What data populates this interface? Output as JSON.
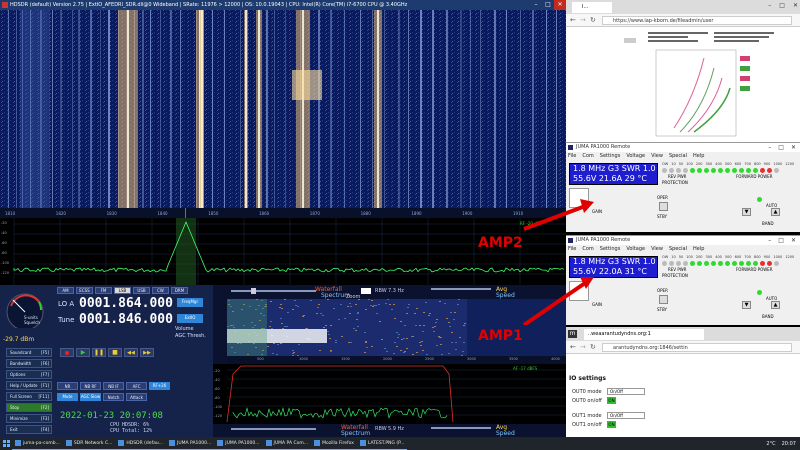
{
  "hdsdr": {
    "title": "HDSDR  (default)  Version 2.75  |  ExtIO_AFEDRI_SDR.dll@0 Wideband  |  SRate: 11976 > 12000  |  OS: 10.0.19043  |  CPU: Intel(R) Core(TM) i7-6700 CPU @ 3.40GHz",
    "freq_ticks": [
      "1810",
      "1820",
      "1830",
      "1840",
      "1850",
      "1860",
      "1870",
      "1880",
      "1890",
      "1900",
      "1910"
    ],
    "spectrum_db": [
      "-20",
      "-40",
      "-60",
      "-80",
      "-100",
      "-120"
    ],
    "spectrum_rf_label": "RF -20 dB",
    "s_meter_label": "S-units\nSquelch",
    "s_meter_value": "-29.7 dBm",
    "lo_label": "LO A",
    "lo_value": "0001.864.000",
    "tune_label": "Tune",
    "tune_value": "0001.846.000",
    "freqmgr": "FreqMgr",
    "extio": "ExtIO",
    "volume": "Volume",
    "agc_thresh": "AGC Thresh.",
    "mode_buttons": [
      "AM",
      "ECSS",
      "FM",
      "LSB",
      "USB",
      "CW",
      "DRM"
    ],
    "left_buttons": [
      {
        "label": "Soundcard",
        "key": "[F5]"
      },
      {
        "label": "Bandwidth",
        "key": "[F6]"
      },
      {
        "label": "Options",
        "key": "[F7]"
      },
      {
        "label": "Help / Update",
        "key": "[F1]"
      },
      {
        "label": "Full Screen",
        "key": "[F11]"
      },
      {
        "label": "Stop",
        "key": "[F2]"
      },
      {
        "label": "Minimize",
        "key": "[F3]"
      },
      {
        "label": "Exit",
        "key": "[F4]"
      }
    ],
    "filter_buttons": [
      "NR",
      "NB RF",
      "NB IF",
      "AFC",
      "RF+26"
    ],
    "agc_buttons": [
      "Mute",
      "AGC Slow",
      "Notch",
      "Attack"
    ],
    "datetime": "2022-01-23 20:07:08",
    "cpu_sdr": "CPU HDSDR:  6%",
    "cpu_total": "CPU Total:  12%",
    "waterfall_label": "Waterfall",
    "spectrum_label": "Spectrum",
    "rbw_label": "RBW",
    "rbw_value": "7.3 Hz",
    "rbw2_value": "5.9 Hz",
    "zoom_label": "Zoom",
    "speed_label": "Speed",
    "avg_label": "Avg",
    "af_label": "AF -17 dBFS",
    "af_freqs": [
      "500",
      "1000",
      "1500",
      "2000",
      "2500",
      "3000",
      "3500",
      "4000"
    ],
    "sub_db": [
      "-20",
      "-40",
      "-60",
      "-80",
      "-100",
      "-120"
    ]
  },
  "browser_top": {
    "tab": "I... ",
    "url": "https://www.iap-kborn.de/fileadmin/user"
  },
  "amp_window_title": "JUMA PA1000 Remote",
  "amp_menu": [
    "File",
    "Com",
    "Settings",
    "Voltage",
    "View",
    "Special",
    "Help"
  ],
  "amp_scale": [
    "OW",
    "10",
    "50",
    "100",
    "200",
    "300",
    "400",
    "500",
    "600",
    "700",
    "800",
    "900",
    "1000",
    "1200"
  ],
  "amp_labels": {
    "rev_pwr": "REV PWR",
    "fwd_pwr": "FORWARD POWER",
    "protection": "PROTECTION",
    "oper": "OPER",
    "stby": "STBY",
    "gain": "GAIN",
    "auto": "AUTO",
    "band": "BAND"
  },
  "amp2": {
    "line1": "1.8 MHz  G3  SWR 1.0",
    "line2": "55.6V   21.6A   29 °C"
  },
  "amp1": {
    "line1": "1.8 MHz  G3  SWR 1.0",
    "line2": "55.6V   22.0A   31 °C"
  },
  "annotations": {
    "amp2": "AMP2",
    "amp1": "AMP1"
  },
  "browser_bottom": {
    "tab": "..weaarantudyndns.org:1",
    "url": "arantudyndns.org:1846/settin",
    "heading": "IO settings",
    "out0_mode": "OUT0 mode",
    "out0_sel": "On/Off",
    "out0_onoff": "OUT0 on/off",
    "out1_mode": "OUT1 mode",
    "out1_sel": "On/Off",
    "out1_onoff": "OUT1 on/off",
    "on": "ON"
  },
  "taskbar": {
    "items": [
      "juma-pa-comb...",
      "SDR Network C...",
      "HDSDR (defau...",
      "JUMA PA1000...",
      "JUMA PA1000...",
      "JUMA PA Com...",
      "Mozilla Firefox",
      "LATEST.PNG (P..."
    ],
    "temp": "2°C",
    "time": "20:07"
  }
}
